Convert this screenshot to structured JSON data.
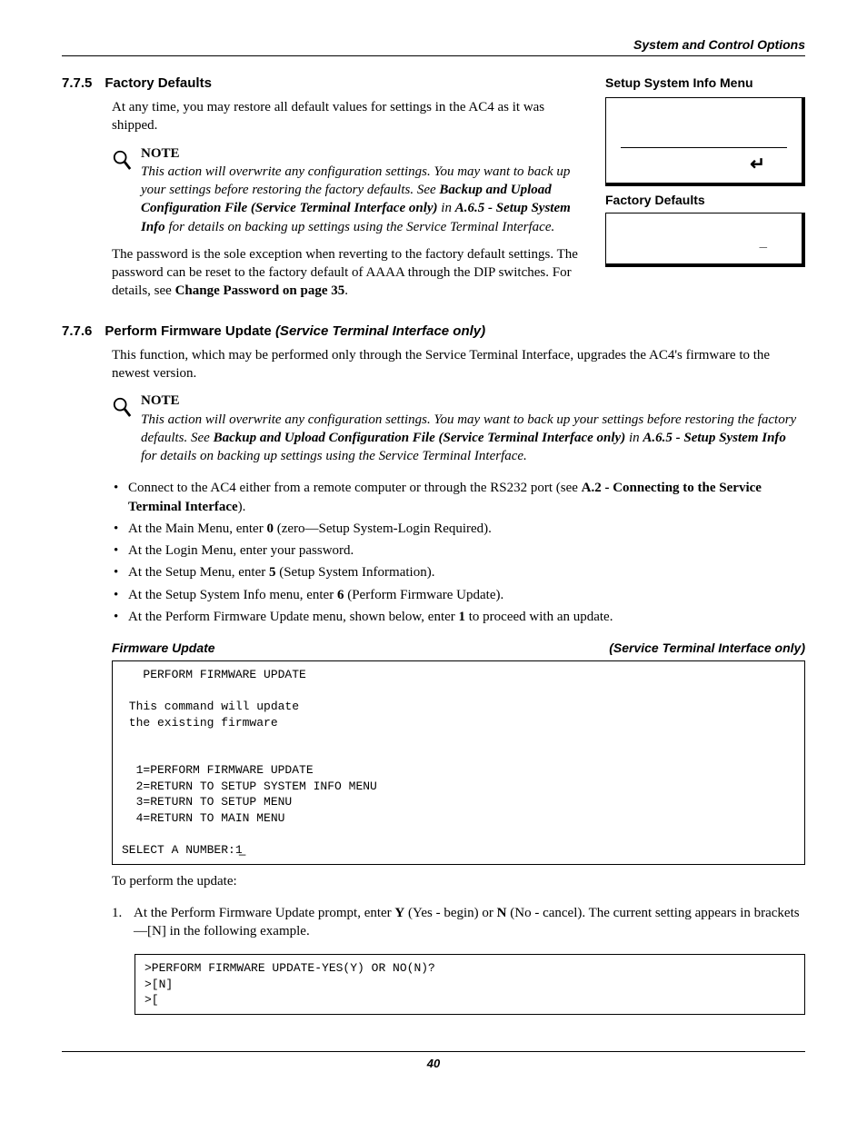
{
  "running_head": "System and Control Options",
  "sec775": {
    "num": "7.7.5",
    "title": "Factory Defaults",
    "p1": "At any time, you may restore all default values for settings in the AC4 as it was shipped.",
    "note": {
      "head": "NOTE",
      "t1": "This action will overwrite any configuration settings. You may want to back up your settings before restoring the factory defaults. See ",
      "ref": "Backup and Upload Configuration File (Service Terminal Interface only)",
      "t2": " in ",
      "ref2": "A.6.5 - Setup System Info",
      "t3": " for details on backing up settings using the Service Terminal Interface."
    },
    "p2a": "The password is the sole exception when reverting to the factory default settings. The password can be reset to the factory default of AAAA through the DIP switches. For details, see ",
    "p2b": "Change Password on page 35",
    "p2c": "."
  },
  "sec776": {
    "num": "7.7.6",
    "title": "Perform Firmware Update ",
    "title_suffix": "(Service Terminal Interface only)",
    "p1": "This function, which may be performed only through the Service Terminal Interface, upgrades the AC4's firmware to the newest version.",
    "note": {
      "head": "NOTE",
      "t1": "This action will overwrite any configuration settings. You may want to back up your settings before restoring the factory defaults. See ",
      "ref": "Backup and Upload Configuration File (Service Terminal Interface only)",
      "t2": " in ",
      "ref2": "A.6.5 - Setup System Info",
      "t3": " for details on backing up settings using the Service Terminal Interface."
    },
    "bullets": {
      "b1a": "Connect to the AC4 either from a remote computer or through the RS232 port (see ",
      "b1b": "A.2 - Connecting to the Service Terminal Interface",
      "b1c": ").",
      "b2a": "At the Main Menu, enter ",
      "b2b": "0",
      "b2c": " (zero—Setup System-Login Required).",
      "b3": "At the Login Menu, enter your password.",
      "b4a": "At the Setup Menu, enter ",
      "b4b": "5",
      "b4c": " (Setup System Information).",
      "b5a": "At the Setup System Info menu, enter ",
      "b5b": "6",
      "b5c": " (Perform Firmware Update).",
      "b6a": "At the Perform Firmware Update menu, shown below, enter ",
      "b6b": "1",
      "b6c": " to proceed with an update."
    },
    "subhead_left": "Firmware Update",
    "subhead_right": "(Service Terminal Interface only)",
    "code1": "   PERFORM FIRMWARE UPDATE\n\n This command will update\n the existing firmware\n\n\n  1=PERFORM FIRMWARE UPDATE\n  2=RETURN TO SETUP SYSTEM INFO MENU\n  3=RETURN TO SETUP MENU\n  4=RETURN TO MAIN MENU\n\nSELECT A NUMBER:1̲",
    "p2": "To perform the update:",
    "ol1a": "At the Perform Firmware Update prompt, enter ",
    "ol1b": "Y",
    "ol1c": " (Yes - begin) or ",
    "ol1d": "N",
    "ol1e": " (No - cancel). The current setting appears in brackets—[N] in the following example.",
    "code2": ">PERFORM FIRMWARE UPDATE-YES(Y) OR NO(N)?\n>[N]\n>["
  },
  "right": {
    "menu_title": "Setup System Info Menu",
    "enter_glyph": "↵",
    "fd_label": "Factory Defaults",
    "cursor": "_"
  },
  "page_number": "40"
}
